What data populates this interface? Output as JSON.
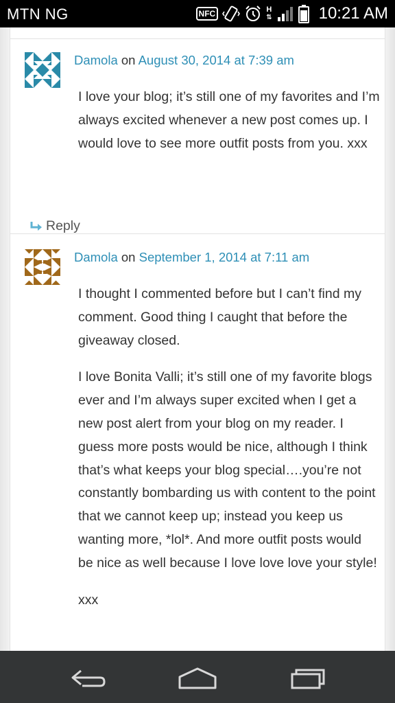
{
  "status_bar": {
    "carrier": "MTN NG",
    "nfc_label": "NFC",
    "network_label": "H",
    "time": "10:21 AM"
  },
  "comments": [
    {
      "author": "Damola",
      "connector": "on",
      "date": "August 30, 2014 at 7:39 am",
      "paragraphs": [
        "I love your blog; it’s still one of my favorites and I’m always excited whenever a new post comes up. I would love to see more outfit posts from you. xxx"
      ],
      "reply_label": "Reply",
      "avatar_color": "#2a8aa8"
    },
    {
      "author": "Damola",
      "connector": "on",
      "date": "September 1, 2014 at 7:11 am",
      "paragraphs": [
        "I thought I commented before but I can’t find my comment. Good thing I caught that before the giveaway closed.",
        "I love Bonita Valli; it’s still one of my favorite blogs ever and I’m always super excited when I get a new post alert from your blog on my reader. I guess more posts would be nice, although I think that’s what keeps your blog special….you’re not constantly bombarding us with content to the point that we cannot keep up; instead you keep us wanting more, *lol*. And more outfit posts would be nice as well because I love love love your style!",
        "xxx"
      ],
      "avatar_color": "#a0681a"
    }
  ],
  "colors": {
    "link": "#2e8fb6",
    "reply_arrow": "#5fb3d3",
    "nav_bg": "#333536"
  }
}
